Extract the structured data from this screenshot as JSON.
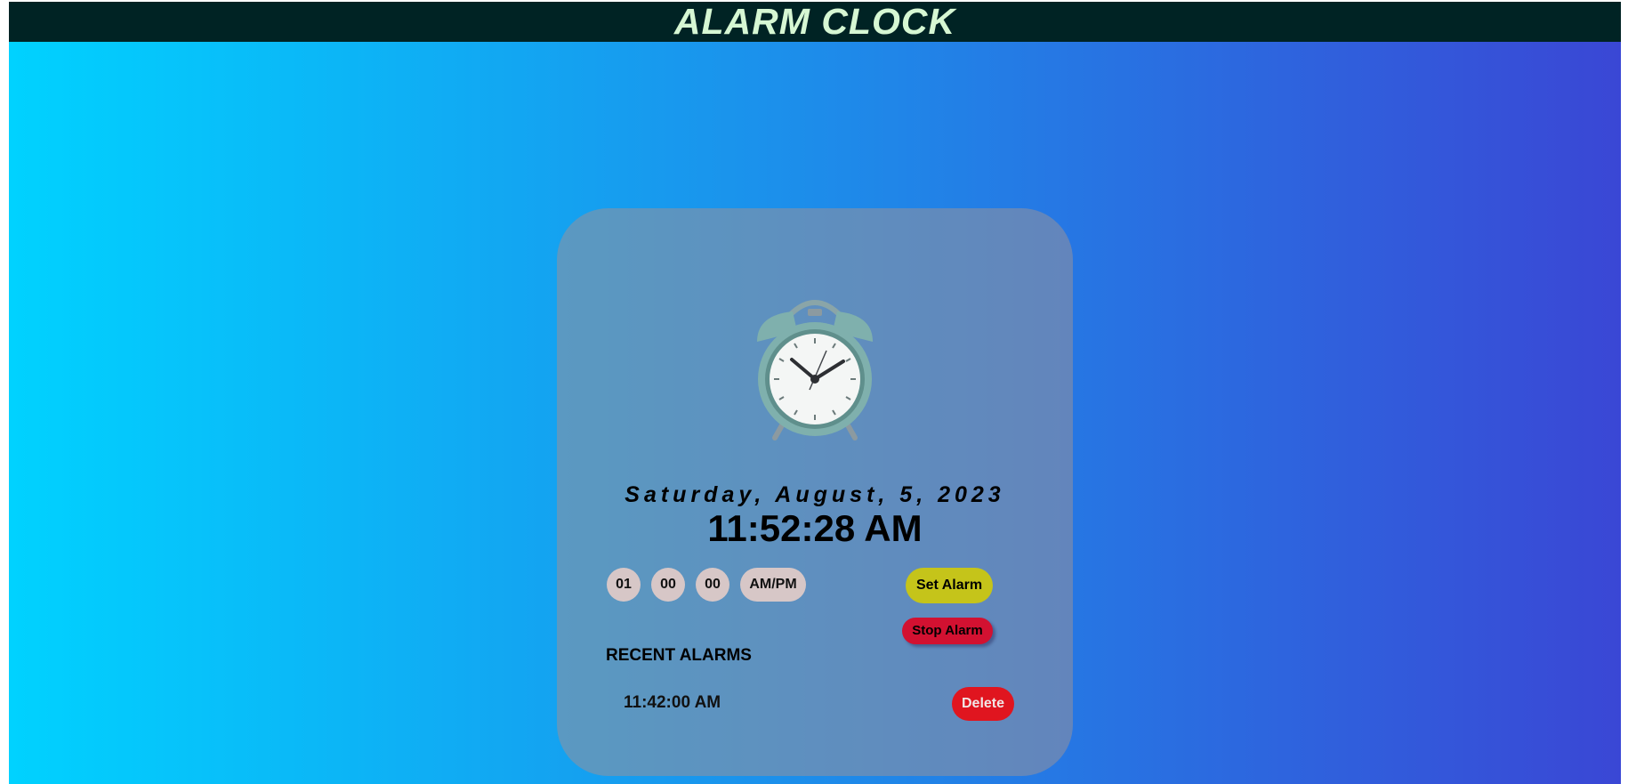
{
  "header": {
    "title": "ALARM CLOCK"
  },
  "clock": {
    "date": "Saturday, August, 5, 2023",
    "time": "11:52:28 AM"
  },
  "alarm_form": {
    "hour": "01",
    "minute": "00",
    "second": "00",
    "ampm": "AM/PM",
    "set_label": "Set Alarm",
    "stop_label": "Stop Alarm"
  },
  "recent": {
    "title": "RECENT ALARMS",
    "items": [
      {
        "time": "11:42:00 AM",
        "delete_label": "Delete"
      }
    ]
  },
  "colors": {
    "header_bg": "#002324",
    "header_text": "#d6f7d3",
    "gradient_start": "#00d2ff",
    "gradient_end": "#3a47d5",
    "set_button": "#c5c41a",
    "stop_button": "#d21131",
    "delete_button": "#e0151f",
    "input_pill": "#d7c7c7"
  },
  "icons": [
    "alarm-clock-icon"
  ]
}
